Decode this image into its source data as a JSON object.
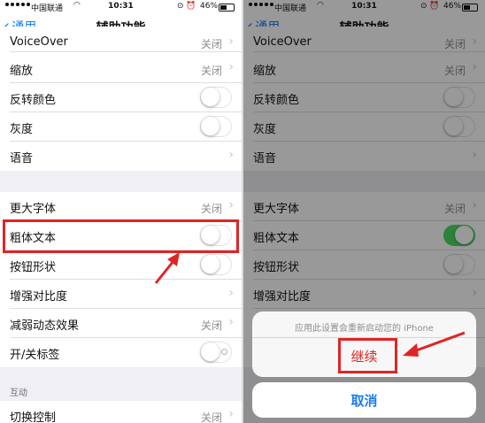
{
  "status_bar": {
    "carrier": "中国联通",
    "time": "10:31",
    "battery": "46%"
  },
  "nav": {
    "back_label": "通用",
    "title": "辅助功能"
  },
  "settings": {
    "voiceover": {
      "label": "VoiceOver",
      "value": "关闭"
    },
    "zoom": {
      "label": "缩放",
      "value": "关闭"
    },
    "invert_colors": {
      "label": "反转颜色"
    },
    "grayscale": {
      "label": "灰度"
    },
    "speech": {
      "label": "语音"
    },
    "larger_text": {
      "label": "更大字体",
      "value": "关闭"
    },
    "bold_text": {
      "label": "粗体文本"
    },
    "button_shapes": {
      "label": "按钮形状"
    },
    "increase_contrast": {
      "label": "增强对比度"
    },
    "reduce_motion": {
      "label": "减弱动态效果",
      "value": "关闭"
    },
    "on_off_labels": {
      "label": "开/关标签"
    },
    "interaction_header": "互动",
    "switch_control": {
      "label": "切换控制",
      "value": "关闭"
    }
  },
  "dialog": {
    "message": "应用此设置会重新启动您的 iPhone",
    "continue_label": "继续",
    "cancel_label": "取消"
  },
  "colors": {
    "accent": "#1a7cf5",
    "toggle_on": "#4cd964",
    "annotation_red": "#e02424"
  }
}
